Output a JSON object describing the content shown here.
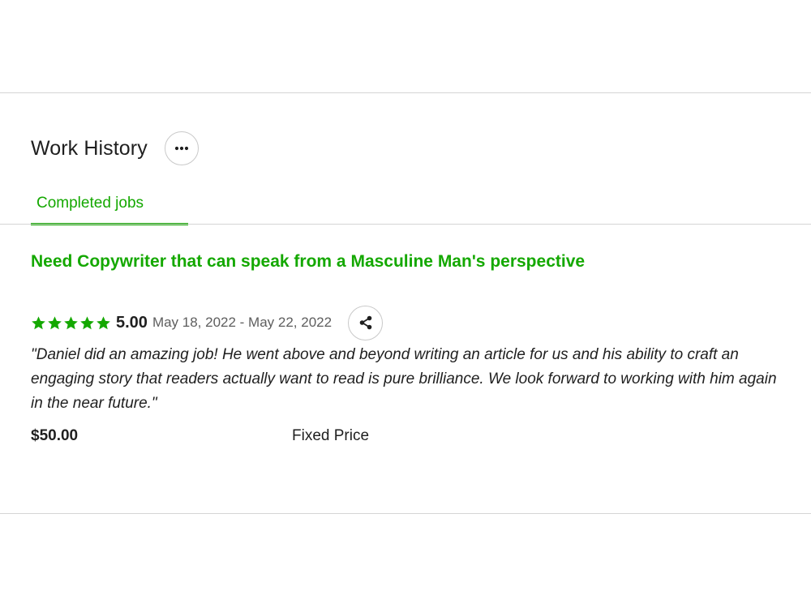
{
  "work_history": {
    "title": "Work History",
    "more_icon": "more-horizontal-icon"
  },
  "tabs": [
    {
      "label": "Completed jobs",
      "active": true
    }
  ],
  "jobs": [
    {
      "title": "Need Copywriter that can speak from a Masculine Man's perspective",
      "rating": 5,
      "rating_label": "5.00",
      "date_range": "May 18, 2022 - May 22, 2022",
      "share_icon": "share-icon",
      "feedback": "\"Daniel did an amazing job! He went above and beyond writing an article for us and his ability to craft an engaging story that readers actually want to read is pure brilliance. We look forward to working with him again in the near future.\"",
      "price": "$50.00",
      "price_type": "Fixed Price"
    }
  ],
  "colors": {
    "accent": "#14a800",
    "text": "#1f1f1f",
    "muted": "#5e5e5e",
    "border": "#d5d5d5"
  }
}
